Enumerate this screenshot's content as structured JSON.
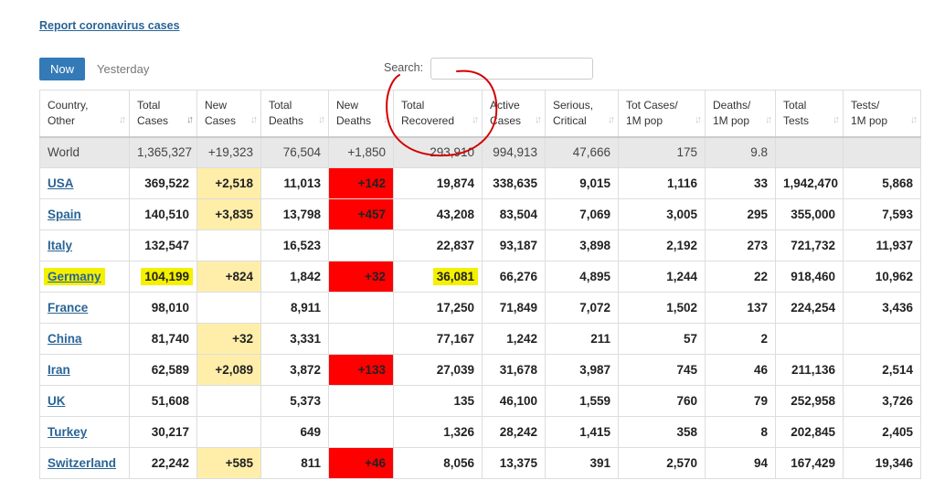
{
  "report_link": "Report coronavirus cases",
  "tabs": {
    "now": "Now",
    "yesterday": "Yesterday"
  },
  "search": {
    "label": "Search:",
    "value": ""
  },
  "columns": [
    "Country,\nOther",
    "Total\nCases",
    "New\nCases",
    "Total\nDeaths",
    "New\nDeaths",
    "Total\nRecovered",
    "Active\nCases",
    "Serious,\nCritical",
    "Tot Cases/\n1M pop",
    "Deaths/\n1M pop",
    "Total\nTests",
    "Tests/\n1M pop"
  ],
  "rows": [
    [
      "World",
      "1,365,327",
      "+19,323",
      "76,504",
      "+1,850",
      "293,910",
      "994,913",
      "47,666",
      "175",
      "9.8",
      "",
      ""
    ],
    [
      "USA",
      "369,522",
      "+2,518",
      "11,013",
      "+142",
      "19,874",
      "338,635",
      "9,015",
      "1,116",
      "33",
      "1,942,470",
      "5,868"
    ],
    [
      "Spain",
      "140,510",
      "+3,835",
      "13,798",
      "+457",
      "43,208",
      "83,504",
      "7,069",
      "3,005",
      "295",
      "355,000",
      "7,593"
    ],
    [
      "Italy",
      "132,547",
      "",
      "16,523",
      "",
      "22,837",
      "93,187",
      "3,898",
      "2,192",
      "273",
      "721,732",
      "11,937"
    ],
    [
      "Germany",
      "104,199",
      "+824",
      "1,842",
      "+32",
      "36,081",
      "66,276",
      "4,895",
      "1,244",
      "22",
      "918,460",
      "10,962"
    ],
    [
      "France",
      "98,010",
      "",
      "8,911",
      "",
      "17,250",
      "71,849",
      "7,072",
      "1,502",
      "137",
      "224,254",
      "3,436"
    ],
    [
      "China",
      "81,740",
      "+32",
      "3,331",
      "",
      "77,167",
      "1,242",
      "211",
      "57",
      "2",
      "",
      ""
    ],
    [
      "Iran",
      "62,589",
      "+2,089",
      "3,872",
      "+133",
      "27,039",
      "31,678",
      "3,987",
      "745",
      "46",
      "211,136",
      "2,514"
    ],
    [
      "UK",
      "51,608",
      "",
      "5,373",
      "",
      "135",
      "46,100",
      "1,559",
      "760",
      "79",
      "252,958",
      "3,726"
    ],
    [
      "Turkey",
      "30,217",
      "",
      "649",
      "",
      "1,326",
      "28,242",
      "1,415",
      "358",
      "8",
      "202,845",
      "2,405"
    ],
    [
      "Switzerland",
      "22,242",
      "+585",
      "811",
      "+46",
      "8,056",
      "13,375",
      "391",
      "2,570",
      "94",
      "167,429",
      "19,346"
    ]
  ],
  "highlight_colors": {
    "new_cases": "#ffeeaa",
    "new_deaths": "#ff0000",
    "marker": "#f4f000",
    "annotation": "#d40000"
  }
}
